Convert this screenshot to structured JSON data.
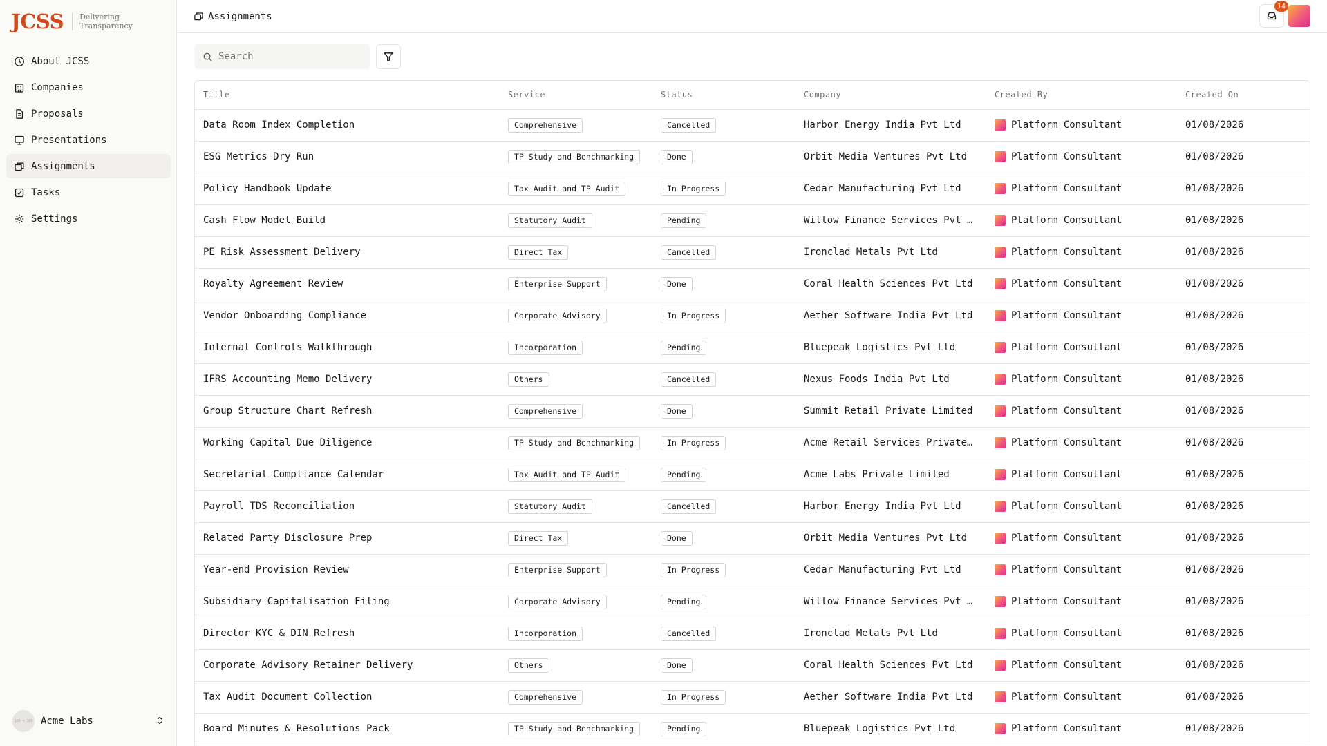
{
  "brand": {
    "logo": "JCSS",
    "tagline_line1": "Delivering",
    "tagline_line2": "Transparency"
  },
  "sidebar": {
    "items": [
      {
        "label": "About JCSS",
        "icon": "info-icon"
      },
      {
        "label": "Companies",
        "icon": "building-icon"
      },
      {
        "label": "Proposals",
        "icon": "document-icon"
      },
      {
        "label": "Presentations",
        "icon": "presentation-icon"
      },
      {
        "label": "Assignments",
        "icon": "stack-icon",
        "active": true
      },
      {
        "label": "Tasks",
        "icon": "checkbox-icon"
      },
      {
        "label": "Settings",
        "icon": "gear-icon"
      }
    ],
    "org": {
      "avatar_text": "100 × 100",
      "name": "Acme Labs"
    }
  },
  "header": {
    "breadcrumb": "Assignments",
    "inbox_count": "14"
  },
  "toolbar": {
    "search_placeholder": "Search"
  },
  "colors": {
    "brand": "#d14a1c",
    "badge": "#e0531f",
    "active_nav": "#f0efed"
  },
  "table": {
    "columns": [
      "Title",
      "Service",
      "Status",
      "Company",
      "Created By",
      "Created On"
    ],
    "rows": [
      {
        "title": "Data Room Index Completion",
        "service": "Comprehensive",
        "status": "Cancelled",
        "company": "Harbor Energy India Pvt Ltd",
        "created_by": "Platform Consultant",
        "created_on": "01/08/2026"
      },
      {
        "title": "ESG Metrics Dry Run",
        "service": "TP Study and Benchmarking",
        "status": "Done",
        "company": "Orbit Media Ventures Pvt Ltd",
        "created_by": "Platform Consultant",
        "created_on": "01/08/2026"
      },
      {
        "title": "Policy Handbook Update",
        "service": "Tax Audit and TP Audit",
        "status": "In Progress",
        "company": "Cedar Manufacturing Pvt Ltd",
        "created_by": "Platform Consultant",
        "created_on": "01/08/2026"
      },
      {
        "title": "Cash Flow Model Build",
        "service": "Statutory Audit",
        "status": "Pending",
        "company": "Willow Finance Services Pvt …",
        "created_by": "Platform Consultant",
        "created_on": "01/08/2026"
      },
      {
        "title": "PE Risk Assessment Delivery",
        "service": "Direct Tax",
        "status": "Cancelled",
        "company": "Ironclad Metals Pvt Ltd",
        "created_by": "Platform Consultant",
        "created_on": "01/08/2026"
      },
      {
        "title": "Royalty Agreement Review",
        "service": "Enterprise Support",
        "status": "Done",
        "company": "Coral Health Sciences Pvt Ltd",
        "created_by": "Platform Consultant",
        "created_on": "01/08/2026"
      },
      {
        "title": "Vendor Onboarding Compliance",
        "service": "Corporate Advisory",
        "status": "In Progress",
        "company": "Aether Software India Pvt Ltd",
        "created_by": "Platform Consultant",
        "created_on": "01/08/2026"
      },
      {
        "title": "Internal Controls Walkthrough",
        "service": "Incorporation",
        "status": "Pending",
        "company": "Bluepeak Logistics Pvt Ltd",
        "created_by": "Platform Consultant",
        "created_on": "01/08/2026"
      },
      {
        "title": "IFRS Accounting Memo Delivery",
        "service": "Others",
        "status": "Cancelled",
        "company": "Nexus Foods India Pvt Ltd",
        "created_by": "Platform Consultant",
        "created_on": "01/08/2026"
      },
      {
        "title": "Group Structure Chart Refresh",
        "service": "Comprehensive",
        "status": "Done",
        "company": "Summit Retail Private Limited",
        "created_by": "Platform Consultant",
        "created_on": "01/08/2026"
      },
      {
        "title": "Working Capital Due Diligence",
        "service": "TP Study and Benchmarking",
        "status": "In Progress",
        "company": "Acme Retail Services Private…",
        "created_by": "Platform Consultant",
        "created_on": "01/08/2026"
      },
      {
        "title": "Secretarial Compliance Calendar",
        "service": "Tax Audit and TP Audit",
        "status": "Pending",
        "company": "Acme Labs Private Limited",
        "created_by": "Platform Consultant",
        "created_on": "01/08/2026"
      },
      {
        "title": "Payroll TDS Reconciliation",
        "service": "Statutory Audit",
        "status": "Cancelled",
        "company": "Harbor Energy India Pvt Ltd",
        "created_by": "Platform Consultant",
        "created_on": "01/08/2026"
      },
      {
        "title": "Related Party Disclosure Prep",
        "service": "Direct Tax",
        "status": "Done",
        "company": "Orbit Media Ventures Pvt Ltd",
        "created_by": "Platform Consultant",
        "created_on": "01/08/2026"
      },
      {
        "title": "Year-end Provision Review",
        "service": "Enterprise Support",
        "status": "In Progress",
        "company": "Cedar Manufacturing Pvt Ltd",
        "created_by": "Platform Consultant",
        "created_on": "01/08/2026"
      },
      {
        "title": "Subsidiary Capitalisation Filing",
        "service": "Corporate Advisory",
        "status": "Pending",
        "company": "Willow Finance Services Pvt …",
        "created_by": "Platform Consultant",
        "created_on": "01/08/2026"
      },
      {
        "title": "Director KYC & DIN Refresh",
        "service": "Incorporation",
        "status": "Cancelled",
        "company": "Ironclad Metals Pvt Ltd",
        "created_by": "Platform Consultant",
        "created_on": "01/08/2026"
      },
      {
        "title": "Corporate Advisory Retainer Delivery",
        "service": "Others",
        "status": "Done",
        "company": "Coral Health Sciences Pvt Ltd",
        "created_by": "Platform Consultant",
        "created_on": "01/08/2026"
      },
      {
        "title": "Tax Audit Document Collection",
        "service": "Comprehensive",
        "status": "In Progress",
        "company": "Aether Software India Pvt Ltd",
        "created_by": "Platform Consultant",
        "created_on": "01/08/2026"
      },
      {
        "title": "Board Minutes & Resolutions Pack",
        "service": "TP Study and Benchmarking",
        "status": "Pending",
        "company": "Bluepeak Logistics Pvt Ltd",
        "created_by": "Platform Consultant",
        "created_on": "01/08/2026"
      }
    ]
  }
}
